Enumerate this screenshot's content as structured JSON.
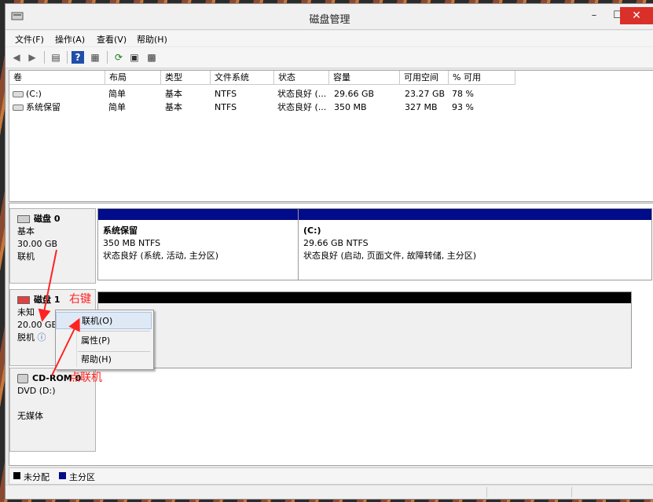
{
  "window": {
    "title": "磁盘管理",
    "minimize": "–",
    "maximize": "☐",
    "close": "✕"
  },
  "menubar": [
    {
      "label": "文件(F)"
    },
    {
      "label": "操作(A)"
    },
    {
      "label": "查看(V)"
    },
    {
      "label": "帮助(H)"
    }
  ],
  "toolbar": [
    "back-icon",
    "forward-icon",
    "show-hide-console-tree-icon",
    "help-icon",
    "properties-icon",
    "refresh-icon",
    "rescan-icon",
    "settings-icon"
  ],
  "volume_table": {
    "headers": [
      "卷",
      "布局",
      "类型",
      "文件系统",
      "状态",
      "容量",
      "可用空间",
      "% 可用"
    ],
    "rows": [
      [
        "(C:)",
        "简单",
        "基本",
        "NTFS",
        "状态良好 (...",
        "29.66 GB",
        "23.27 GB",
        "78 %"
      ],
      [
        "系统保留",
        "简单",
        "基本",
        "NTFS",
        "状态良好 (...",
        "350 MB",
        "327 MB",
        "93 %"
      ]
    ]
  },
  "disks": [
    {
      "name": "磁盘 0",
      "type": "基本",
      "size": "30.00 GB",
      "state": "联机"
    },
    {
      "name": "磁盘 1",
      "type": "未知",
      "size": "20.00 GB",
      "state": "脱机"
    },
    {
      "name": "CD-ROM 0",
      "type": "DVD (D:)",
      "size": "",
      "state": "无媒体"
    }
  ],
  "partitions": [
    {
      "name": "系统保留",
      "size": "350 MB NTFS",
      "status": "状态良好 (系统, 活动, 主分区)"
    },
    {
      "name": "(C:)",
      "size": "29.66 GB NTFS",
      "status": "状态良好 (启动, 页面文件, 故障转储, 主分区)"
    }
  ],
  "context_menu": [
    {
      "label": "联机(O)"
    },
    {
      "label": "属性(P)"
    },
    {
      "label": "帮助(H)"
    }
  ],
  "annotations": {
    "right_click": "右键",
    "click_online": "点联机"
  },
  "legend": [
    {
      "label": "未分配",
      "color": "#000000"
    },
    {
      "label": "主分区",
      "color": "#000c8a"
    }
  ],
  "colors": {
    "primary_partition": "#000c8a",
    "unallocated": "#000000",
    "close_button": "#d9302a",
    "annotation": "#ff2222"
  }
}
